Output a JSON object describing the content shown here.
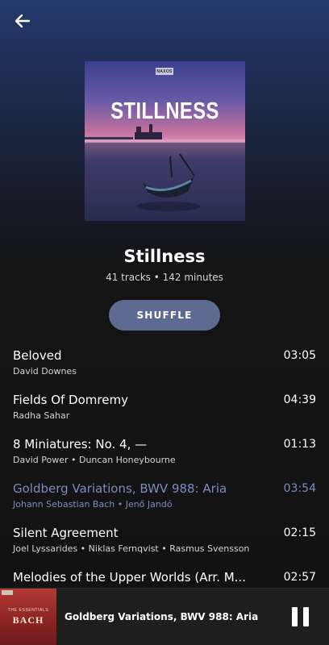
{
  "header": {
    "back_icon": "arrow-left-icon"
  },
  "album": {
    "cover_badge": "NAXOS",
    "cover_title": "STILLNESS",
    "title": "Stillness",
    "meta": "41 tracks • 142 minutes"
  },
  "actions": {
    "shuffle_label": "SHUFFLE"
  },
  "tracks": [
    {
      "title": "Beloved",
      "artists": "David Downes",
      "duration": "03:05",
      "active": false
    },
    {
      "title": "Fields Of Domremy",
      "artists": "Radha Sahar",
      "duration": "04:39",
      "active": false
    },
    {
      "title": "8 Miniatures: No. 4, —",
      "artists": "David Power • Duncan Honeybourne",
      "duration": "01:13",
      "active": false
    },
    {
      "title": "Goldberg Variations, BWV 988: Aria",
      "artists": "Johann Sebastian Bach • Jenő Jandó",
      "duration": "03:54",
      "active": true
    },
    {
      "title": "Silent Agreement",
      "artists": "Joel Lyssarides • Niklas Fernqvist • Rasmus Svensson",
      "duration": "02:15",
      "active": false
    },
    {
      "title": "Melodies of the Upper Worlds (Arr. M...",
      "artists": "",
      "duration": "02:57",
      "active": false
    }
  ],
  "now_playing": {
    "art_subtitle": "THE ESSENTIALS",
    "art_title": "BACH",
    "title": "Goldberg Variations, BWV 988: Aria",
    "control_icon": "pause-icon"
  },
  "colors": {
    "accent": "#7c8dc4",
    "shuffle_button": "#5d6a91",
    "background": "#121212"
  }
}
